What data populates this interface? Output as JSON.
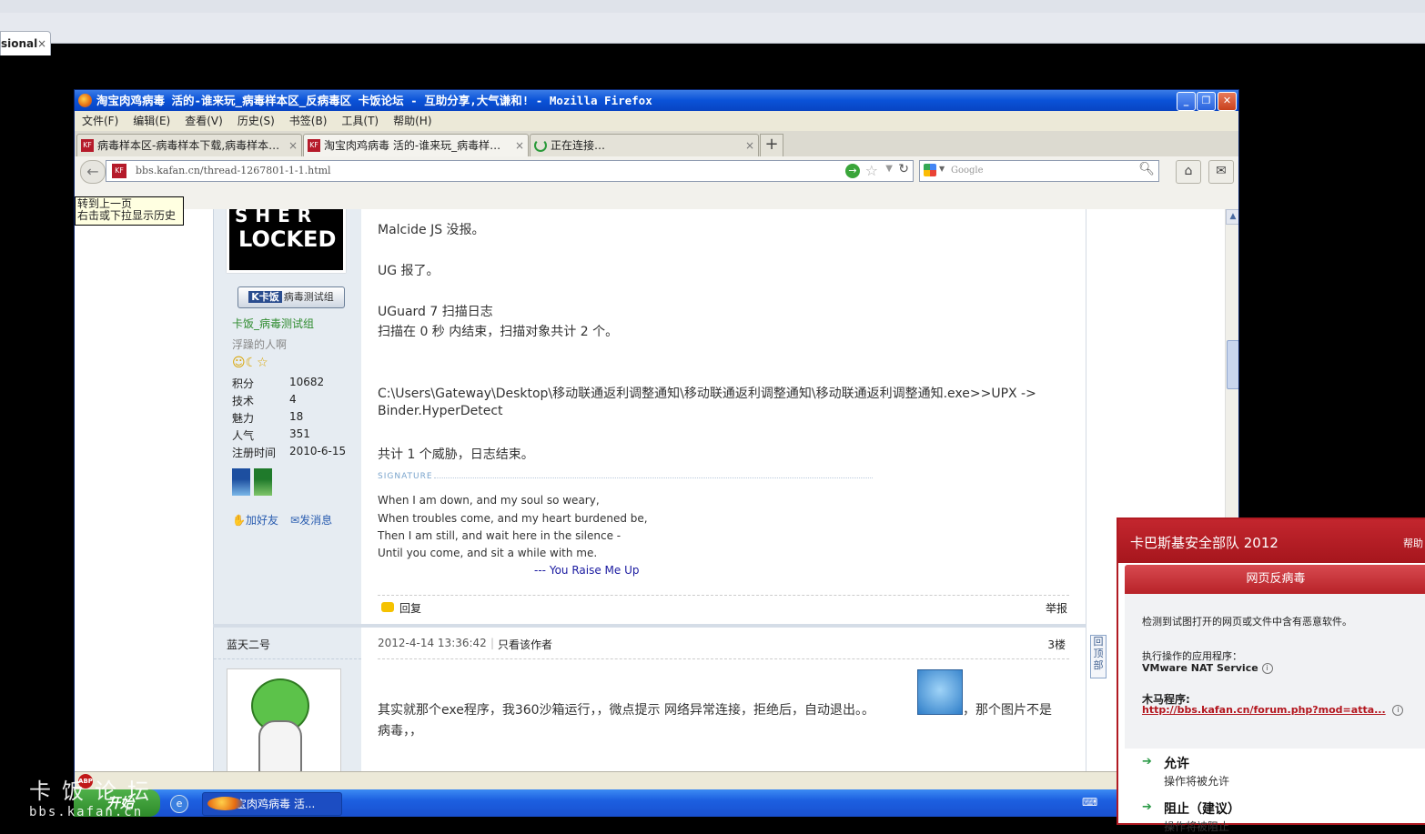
{
  "host": {
    "tab_label": "sional",
    "tab_close": "×"
  },
  "window": {
    "title": "淘宝肉鸡病毒 活的-谁来玩_病毒样本区_反病毒区 卡饭论坛 - 互助分享,大气谦和! - Mozilla Firefox",
    "buttons": {
      "minimize": "_",
      "restore": "❐",
      "close": "✕"
    }
  },
  "menu": [
    "文件(F)",
    "编辑(E)",
    "查看(V)",
    "历史(S)",
    "书签(B)",
    "工具(T)",
    "帮助(H)"
  ],
  "tabs": [
    {
      "label": "病毒样本区-病毒样本下载,病毒样本…",
      "close": "×"
    },
    {
      "label": "淘宝肉鸡病毒 活的-谁来玩_病毒样…",
      "close": "×"
    },
    {
      "label": "正在连接…",
      "close": "×"
    }
  ],
  "new_tab": "+",
  "url": "bbs.kafan.cn/thread-1267801-1-1.html",
  "search_placeholder": "Google",
  "tooltip": {
    "line1": "转到上一页",
    "line2": "右击或下拉显示历史"
  },
  "post1": {
    "avatar_text1": "SHER",
    "avatar_text2": "LOCKED",
    "badge_logo": "K卡饭",
    "badge_text": "病毒测试组",
    "group": "卡饭_病毒测试组",
    "title": "浮躁的人啊",
    "stats": [
      {
        "k": "积分",
        "v": "10682"
      },
      {
        "k": "技术",
        "v": "4"
      },
      {
        "k": "魅力",
        "v": "18"
      },
      {
        "k": "人气",
        "v": "351"
      },
      {
        "k": "注册时间",
        "v": "2010-6-15"
      }
    ],
    "add_friend": "加好友",
    "send_msg": "发消息",
    "lines": [
      "Malcide JS 没报。",
      "UG 报了。",
      "UGuard 7 扫描日志",
      "扫描在 0 秒 内结束，扫描对象共计 2 个。",
      "C:\\Users\\Gateway\\Desktop\\移动联通返利调整通知\\移动联通返利调整通知\\移动联通返利调整通知.exe>>UPX ->",
      "Binder.HyperDetect",
      "共计 1 个威胁，日志结束。"
    ],
    "signature_label": "SIGNATURE",
    "signature": [
      "When I am down, and my soul so weary,",
      "When troubles come, and my heart burdened be,",
      "Then I am still, and wait here in the silence -",
      "Until you come, and sit a while with me."
    ],
    "sig_dash": "---",
    "sig_song": "You Raise Me Up",
    "reply": "回复",
    "report": "举报"
  },
  "post2": {
    "author": "蓝天二号",
    "date": "2012-4-14 13:36:42",
    "only_author": "只看该作者",
    "floor": "3楼",
    "text_a": "其实就那个exe程序，我360沙箱运行，，微点提示 网络异常连接，拒绝后，自动退出。。",
    "text_b": "，那个图片不是",
    "text_c": "病毒，，"
  },
  "totop": "回顶部",
  "taskbar": {
    "start": "开始",
    "item": "淘宝肉鸡病毒 活..."
  },
  "watermark": {
    "cn": "卡饭论坛",
    "url": "bbs.kafan.cn"
  },
  "kaspersky": {
    "title": "卡巴斯基安全部队 2012",
    "help": "帮助",
    "section": "网页反病毒",
    "desc": "检测到试图打开的网页或文件中含有恶意软件。",
    "app_label": "执行操作的应用程序：",
    "app": "VMware NAT Service",
    "trojan_label": "木马程序:",
    "link": "http://bbs.kafan.cn/forum.php?mod=atta...",
    "allow": "允许",
    "allow_sub": "操作将被允许",
    "block": "阻止（建议）",
    "block_sub": "操作将被阻止"
  }
}
